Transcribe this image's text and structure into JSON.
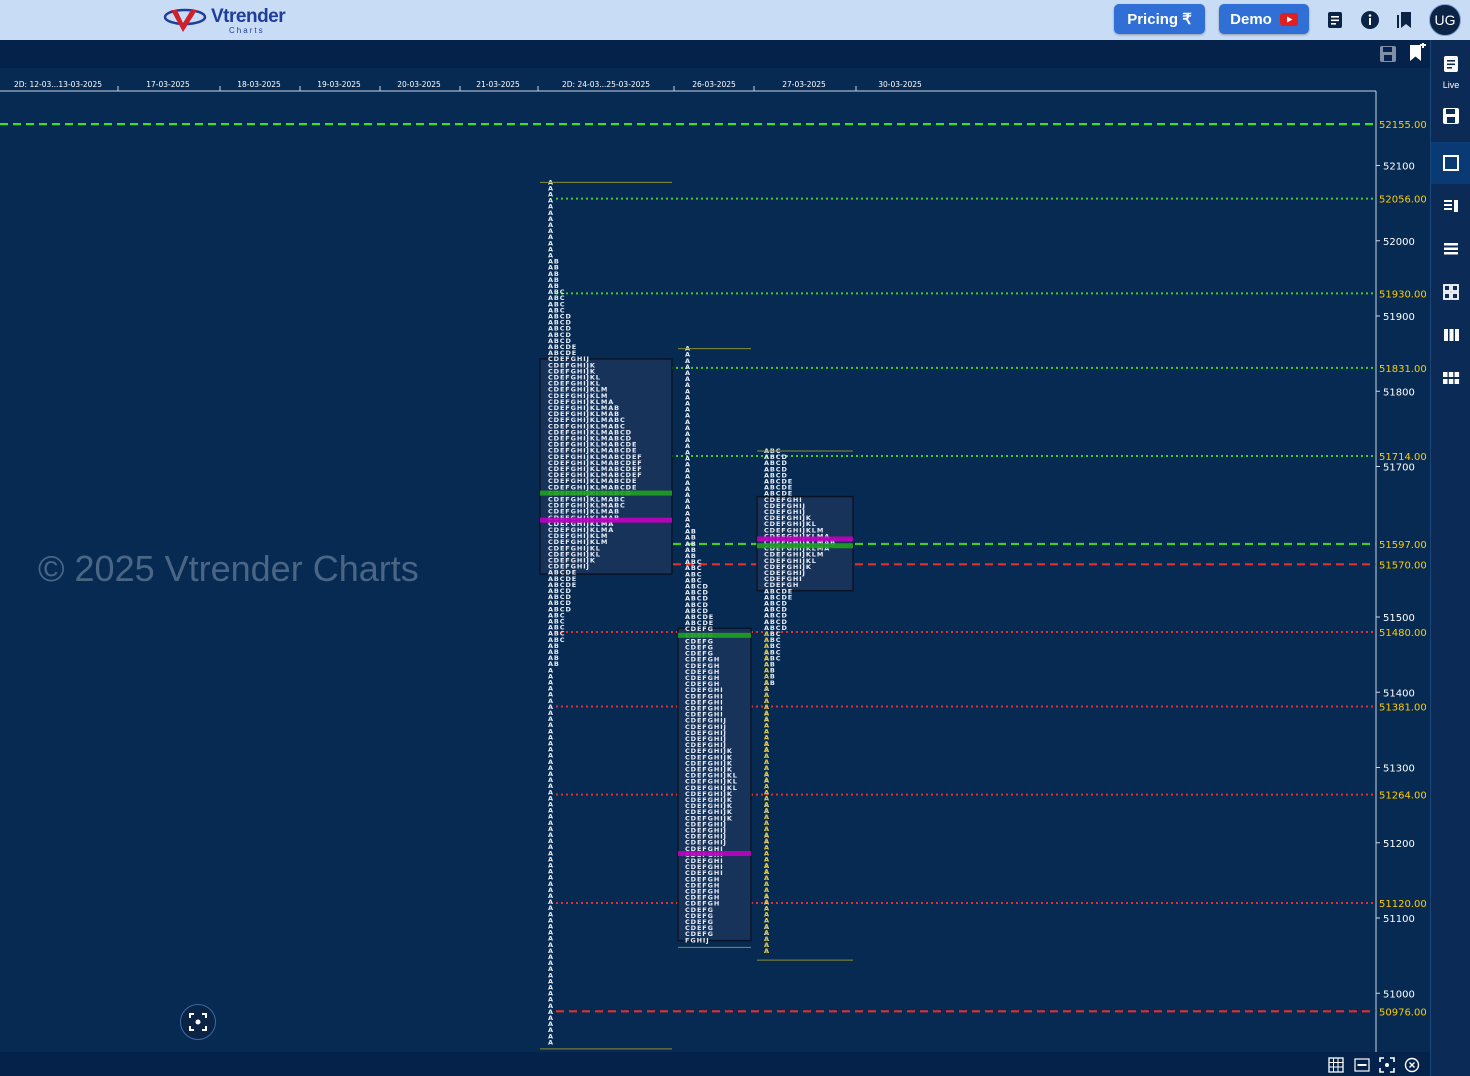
{
  "header": {
    "logo_text": "Vtrender",
    "logo_sub": "Charts",
    "pricing_label": "Pricing ₹",
    "demo_label": "Demo",
    "avatar_initials": "UG"
  },
  "sidebar": {
    "live_label": "Live"
  },
  "watermark": "© 2025 Vtrender Charts",
  "colors": {
    "background": "#062a52",
    "letters": "#e8eef8",
    "open_letters": "#e0c020",
    "poc": "#c000c0",
    "vwap": "#20a020",
    "resistance_line": "#44cc22",
    "support_line": "#e03030",
    "axis_label": "#ffffff",
    "level_label": "#ffcc00"
  },
  "chart_data": {
    "type": "table",
    "title": "",
    "x_dates": [
      "2D: 12-03...13-03-2025",
      "17-03-2025",
      "18-03-2025",
      "19-03-2025",
      "20-03-2025",
      "21-03-2025",
      "2D: 24-03...25-03-2025",
      "26-03-2025",
      "27-03-2025",
      "30-03-2025"
    ],
    "y_ticks": [
      52100,
      52000,
      51900,
      51800,
      51700,
      51500,
      51400,
      51300,
      51200,
      51100,
      51000
    ],
    "ylim": [
      50930,
      52200
    ],
    "reference_levels": [
      {
        "price": 52155.0,
        "label": "52155.00",
        "style": "dashed",
        "color": "#44dd22"
      },
      {
        "price": 52056.0,
        "label": "52056.00",
        "style": "dotted",
        "color": "#44cc22"
      },
      {
        "price": 51930.0,
        "label": "51930.00",
        "style": "dotted",
        "color": "#44cc22"
      },
      {
        "price": 51831.0,
        "label": "51831.00",
        "style": "dotted",
        "color": "#44cc22"
      },
      {
        "price": 51714.0,
        "label": "51714.00",
        "style": "dotted",
        "color": "#44cc22"
      },
      {
        "price": 51597.0,
        "label": "51597.00",
        "style": "dashed",
        "color": "#44cc22"
      },
      {
        "price": 51570.0,
        "label": "51570.00",
        "style": "dashed",
        "color": "#e03030"
      },
      {
        "price": 51480.0,
        "label": "51480.00",
        "style": "dotted",
        "color": "#e03030"
      },
      {
        "price": 51381.0,
        "label": "51381.00",
        "style": "dotted",
        "color": "#e03030"
      },
      {
        "price": 51264.0,
        "label": "51264.00",
        "style": "dotted",
        "color": "#e03030"
      },
      {
        "price": 51120.0,
        "label": "51120.00",
        "style": "dotted",
        "color": "#e03030"
      },
      {
        "price": 50976.0,
        "label": "50976.00",
        "style": "dashed",
        "color": "#e03030"
      }
    ],
    "profiles": [
      {
        "date": "2D: 24-03...25-03-2025",
        "high": 52075,
        "low": 50930,
        "va_high": 51843,
        "va_low": 51557,
        "poc": 51628,
        "vwap": 51664,
        "single_print_letter": "A"
      },
      {
        "date": "26-03-2025",
        "high": 51854,
        "low": 51065,
        "va_high": 51485,
        "va_low": 51070,
        "poc": 51185,
        "vwap": 51475,
        "single_print_letter": "H"
      },
      {
        "date": "27-03-2025",
        "high": 51718,
        "low": 51048,
        "va_high": 51660,
        "va_low": 51535,
        "poc": 51603,
        "vwap": 51594,
        "single_print_letter": "A"
      }
    ]
  }
}
